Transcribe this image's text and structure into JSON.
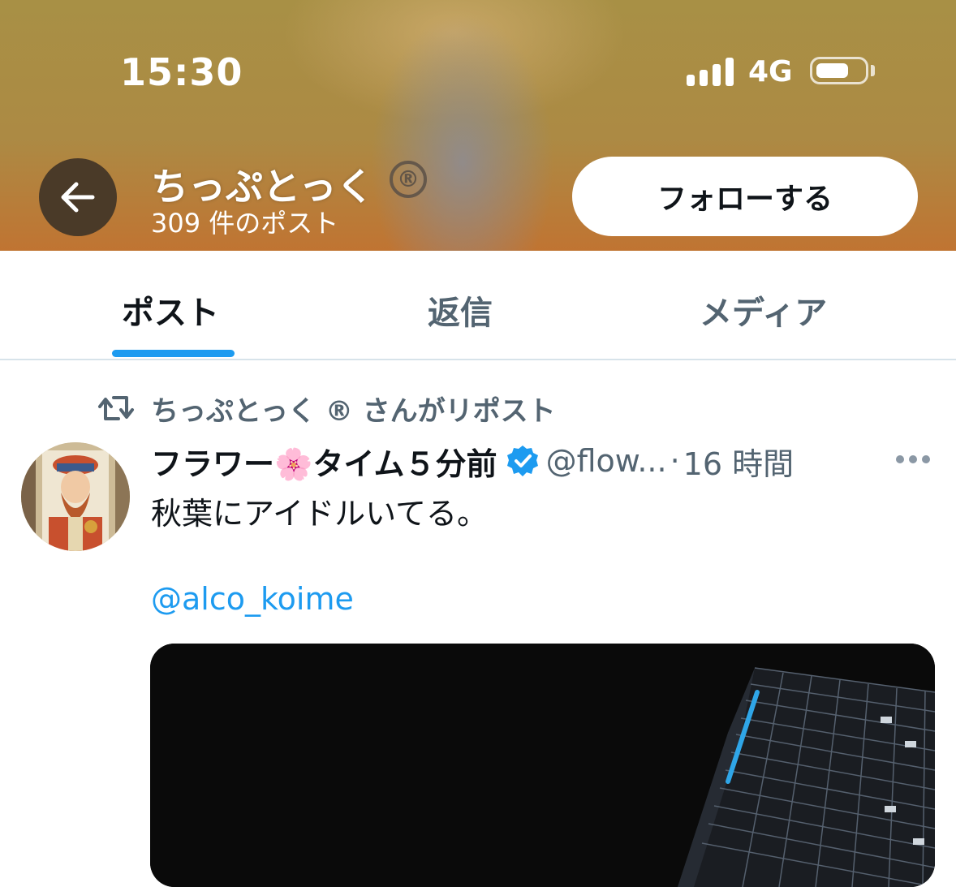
{
  "status_bar": {
    "time": "15:30",
    "network": "4G",
    "signal_bars": 4,
    "battery_level": 0.65
  },
  "profile_header": {
    "name": "ちっぷとっく",
    "registered_mark": "®",
    "post_count": "309 件のポスト",
    "follow_label": "フォローする",
    "back_icon": "arrow-left-icon"
  },
  "tabs": [
    {
      "label": "ポスト",
      "active": true
    },
    {
      "label": "返信",
      "active": false
    },
    {
      "label": "メディア",
      "active": false
    }
  ],
  "tweet": {
    "repost_text": "ちっぷとっく ® さんがリポスト",
    "author_name": "フラワー🌸タイム５分前",
    "handle": "@flow...",
    "separator": "·",
    "time": "16 時間",
    "text": "秋葉にアイドルいてる。",
    "mention": "@alco_koime"
  },
  "colors": {
    "accent": "#1d9bf0",
    "text_primary": "#0f1419",
    "text_secondary": "#536471"
  }
}
